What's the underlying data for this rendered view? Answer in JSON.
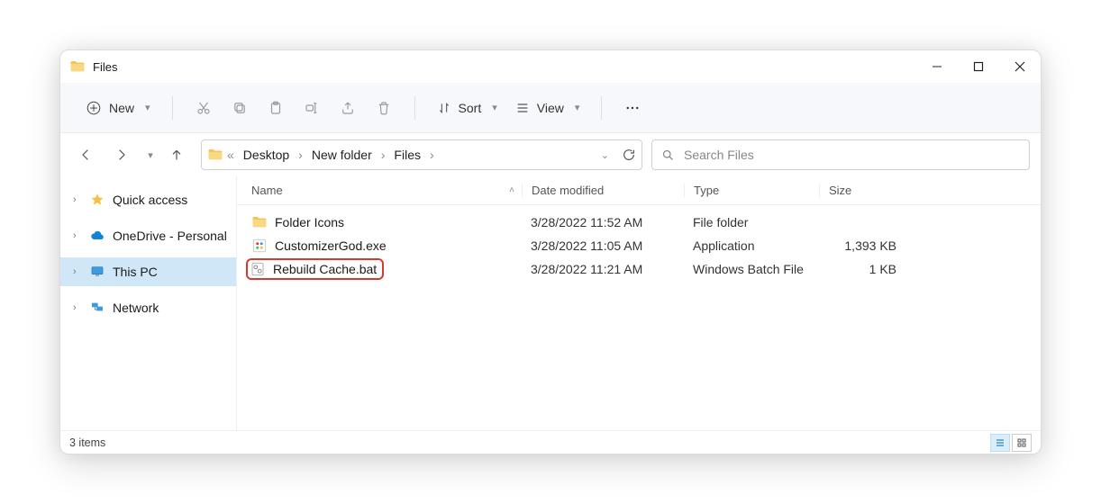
{
  "window": {
    "title": "Files"
  },
  "commandbar": {
    "new_label": "New",
    "sort_label": "Sort",
    "view_label": "View"
  },
  "breadcrumb": {
    "items": [
      "Desktop",
      "New folder",
      "Files"
    ]
  },
  "search": {
    "placeholder": "Search Files"
  },
  "sidebar": {
    "items": [
      {
        "label": "Quick access"
      },
      {
        "label": "OneDrive - Personal"
      },
      {
        "label": "This PC"
      },
      {
        "label": "Network"
      }
    ]
  },
  "columns": {
    "name": "Name",
    "date": "Date modified",
    "type": "Type",
    "size": "Size"
  },
  "files": [
    {
      "name": "Folder Icons",
      "date": "3/28/2022 11:52 AM",
      "type": "File folder",
      "size": ""
    },
    {
      "name": "CustomizerGod.exe",
      "date": "3/28/2022 11:05 AM",
      "type": "Application",
      "size": "1,393 KB"
    },
    {
      "name": "Rebuild Cache.bat",
      "date": "3/28/2022 11:21 AM",
      "type": "Windows Batch File",
      "size": "1 KB"
    }
  ],
  "status": {
    "count_label": "3 items"
  }
}
